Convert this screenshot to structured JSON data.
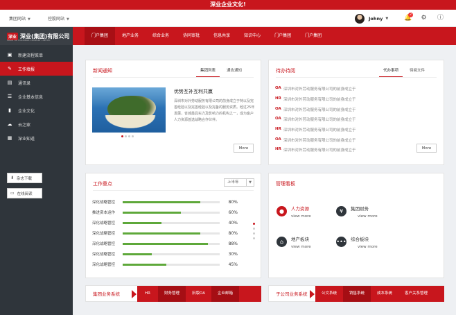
{
  "banner": "深业企业文化!",
  "header": {
    "select1": "集团网站",
    "select2": "控股网站",
    "user_name": "Johny",
    "notif_count": "2"
  },
  "sidebar": {
    "logo_mark": "深业",
    "logo_name": "深业(集团)有限公司",
    "logo_sub": "SHUM YIP HOLDINGS COMPANY LIMITED",
    "items": [
      {
        "label": "新建流程菜单",
        "icon": "document-plus-icon"
      },
      {
        "label": "工作填报",
        "icon": "edit-icon"
      },
      {
        "label": "通讯录",
        "icon": "contacts-icon"
      },
      {
        "label": "企业基本信息",
        "icon": "list-icon"
      },
      {
        "label": "企业文化",
        "icon": "book-icon"
      },
      {
        "label": "云之家",
        "icon": "cloud-icon"
      },
      {
        "label": "深业知道",
        "icon": "knowledge-icon"
      }
    ],
    "buttons": [
      {
        "label": "杂志下载",
        "icon": "download-icon"
      },
      {
        "label": "在线阅读",
        "icon": "read-icon"
      }
    ]
  },
  "nav": [
    "门户集团",
    "地产业务",
    "综合业务",
    "协同审批",
    "信息共享",
    "知识中心",
    "门户集团",
    "门户集团"
  ],
  "news": {
    "title": "新闻通知",
    "tabs": [
      "集团列表",
      "通告通知"
    ],
    "headline": "优势互补互利共赢",
    "body": "深圳市对外劳动服务有限公司的前身成立于特以及完善经验以及完善经验以及完备的服务资质。经过25年发展，省城最具实力及影响力的机构之一，成为客户人力资源首选战略合作伙伴。",
    "more": "More"
  },
  "todo": {
    "title": "待办待阅",
    "tabs": [
      "代办事项",
      "待阅文件"
    ],
    "items": [
      {
        "tag": "OA",
        "text": "深圳市对外劳动服务有限公司的前身成立于"
      },
      {
        "tag": "HR",
        "text": "深圳市对外劳动服务有限公司的前身成立于"
      },
      {
        "tag": "OA",
        "text": "深圳市对外劳动服务有限公司的前身成立于"
      },
      {
        "tag": "OA",
        "text": "深圳市对外劳动服务有限公司的前身成立于"
      },
      {
        "tag": "HR",
        "text": "深圳市对外劳动服务有限公司的前身成立于"
      },
      {
        "tag": "OA",
        "text": "深圳市对外劳动服务有限公司的前身成立于"
      },
      {
        "tag": "HR",
        "text": "深圳市对外劳动服务有限公司的前身成立于"
      }
    ],
    "more": "More"
  },
  "work": {
    "title": "工作重点",
    "period": "上半年",
    "rows": [
      {
        "label": "深化战略管控",
        "value": 80,
        "display": "80%"
      },
      {
        "label": "推进资本运作",
        "value": 60,
        "display": "60%"
      },
      {
        "label": "深化战略管控",
        "value": 40,
        "display": "40%"
      },
      {
        "label": "深化战略管控",
        "value": 80,
        "display": "80%"
      },
      {
        "label": "深化战略管控",
        "value": 88,
        "display": "88%"
      },
      {
        "label": "深化战略管控",
        "value": 30,
        "display": "30%"
      },
      {
        "label": "深化战略管控",
        "value": 45,
        "display": "45%"
      }
    ]
  },
  "board": {
    "title": "管理看板",
    "items": [
      {
        "label": "人力资源",
        "link": "view more",
        "icon": "user-icon",
        "color": "#c8161d"
      },
      {
        "label": "集团财务",
        "link": "view more",
        "icon": "yen-icon",
        "color": "#2f353b"
      },
      {
        "label": "地产板块",
        "link": "view more",
        "icon": "home-icon",
        "color": "#2f353b"
      },
      {
        "label": "综合板块",
        "link": "view more",
        "icon": "more-icon",
        "color": "#2f353b"
      }
    ]
  },
  "group_systems": {
    "title": "集团业务系统",
    "tabs": [
      "HR",
      "财务管理",
      "旧版OA",
      "企业邮箱"
    ]
  },
  "sub_systems": {
    "title": "子公司业务系统",
    "tabs": [
      "公文系统",
      "销售系统",
      "成本系统",
      "客户关系管理"
    ]
  },
  "colors": {
    "brand": "#c8161d",
    "sidebar": "#2f353b",
    "progress": "#5ea83a"
  }
}
